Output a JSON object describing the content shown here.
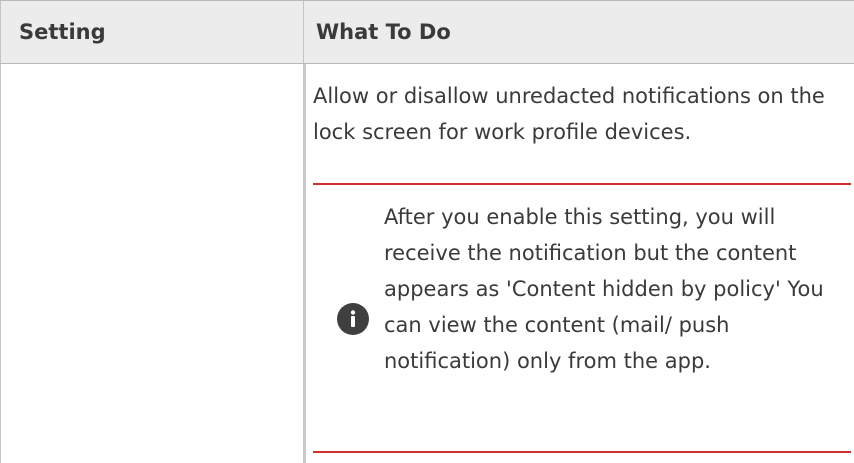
{
  "table": {
    "headers": {
      "setting": "Setting",
      "what_to_do": "What To Do"
    },
    "row": {
      "setting": "",
      "description": "Allow or disallow unredacted notifications on the lock screen for work profile devices.",
      "note": {
        "icon": "info-icon",
        "text": "After you enable this setting, you will receive the notification but the content appears as 'Content hidden by policy' You can view the content (mail/ push notification) only from the app."
      }
    }
  },
  "colors": {
    "header_background": "#ececec",
    "note_rule": "#d0312d",
    "icon_fill": "#3f3f3f"
  }
}
